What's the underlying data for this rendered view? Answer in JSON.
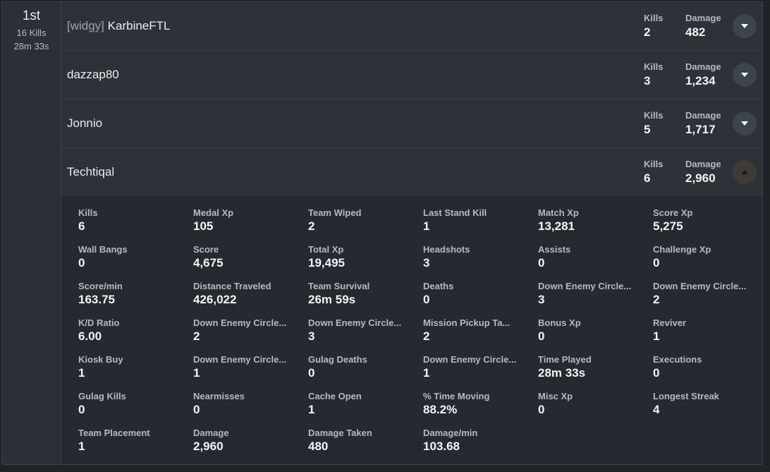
{
  "team": {
    "rank": "1st",
    "kills": "16 Kills",
    "time": "28m 33s"
  },
  "labels": {
    "kills": "Kills",
    "damage": "Damage"
  },
  "players": [
    {
      "clan": "[widgy]",
      "name": "KarbineFTL",
      "kills": "2",
      "damage": "482",
      "expanded": false
    },
    {
      "clan": "",
      "name": "dazzap80",
      "kills": "3",
      "damage": "1,234",
      "expanded": false
    },
    {
      "clan": "",
      "name": "Jonnio",
      "kills": "5",
      "damage": "1,717",
      "expanded": false
    },
    {
      "clan": "",
      "name": "Techtiqal",
      "kills": "6",
      "damage": "2,960",
      "expanded": true
    }
  ],
  "icons": {
    "collapsed": "chevron-down-icon",
    "expanded": "chevron-up-icon"
  },
  "colors": {
    "icon_default": "#ffffff",
    "icon_active": "#1c1a17"
  },
  "details": [
    {
      "label": "Kills",
      "value": "6"
    },
    {
      "label": "Medal Xp",
      "value": "105"
    },
    {
      "label": "Team Wiped",
      "value": "2"
    },
    {
      "label": "Last Stand Kill",
      "value": "1"
    },
    {
      "label": "Match Xp",
      "value": "13,281"
    },
    {
      "label": "Score Xp",
      "value": "5,275"
    },
    {
      "label": "Wall Bangs",
      "value": "0"
    },
    {
      "label": "Score",
      "value": "4,675"
    },
    {
      "label": "Total Xp",
      "value": "19,495"
    },
    {
      "label": "Headshots",
      "value": "3"
    },
    {
      "label": "Assists",
      "value": "0"
    },
    {
      "label": "Challenge Xp",
      "value": "0"
    },
    {
      "label": "Score/min",
      "value": "163.75"
    },
    {
      "label": "Distance Traveled",
      "value": "426,022"
    },
    {
      "label": "Team Survival",
      "value": "26m 59s"
    },
    {
      "label": "Deaths",
      "value": "0"
    },
    {
      "label": "Down Enemy Circle...",
      "value": "3"
    },
    {
      "label": "Down Enemy Circle...",
      "value": "2"
    },
    {
      "label": "K/D Ratio",
      "value": "6.00"
    },
    {
      "label": "Down Enemy Circle...",
      "value": "2"
    },
    {
      "label": "Down Enemy Circle...",
      "value": "3"
    },
    {
      "label": "Mission Pickup Ta...",
      "value": "2"
    },
    {
      "label": "Bonus Xp",
      "value": "0"
    },
    {
      "label": "Reviver",
      "value": "1"
    },
    {
      "label": "Kiosk Buy",
      "value": "1"
    },
    {
      "label": "Down Enemy Circle...",
      "value": "1"
    },
    {
      "label": "Gulag Deaths",
      "value": "0"
    },
    {
      "label": "Down Enemy Circle...",
      "value": "1"
    },
    {
      "label": "Time Played",
      "value": "28m 33s"
    },
    {
      "label": "Executions",
      "value": "0"
    },
    {
      "label": "Gulag Kills",
      "value": "0"
    },
    {
      "label": "Nearmisses",
      "value": "0"
    },
    {
      "label": "Cache Open",
      "value": "1"
    },
    {
      "label": "% Time Moving",
      "value": "88.2%"
    },
    {
      "label": "Misc Xp",
      "value": "0"
    },
    {
      "label": "Longest Streak",
      "value": "4"
    },
    {
      "label": "Team Placement",
      "value": "1"
    },
    {
      "label": "Damage",
      "value": "2,960"
    },
    {
      "label": "Damage Taken",
      "value": "480"
    },
    {
      "label": "Damage/min",
      "value": "103.68"
    }
  ]
}
